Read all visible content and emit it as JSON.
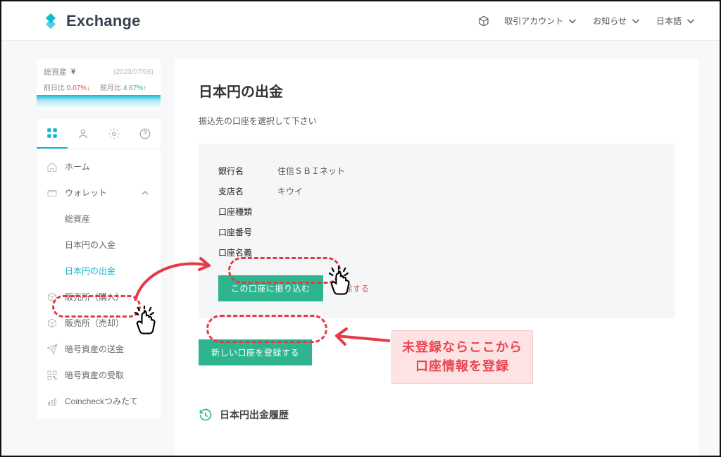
{
  "brand": "Exchange",
  "header": {
    "account": "取引アカウント",
    "notice": "お知らせ",
    "lang": "日本語"
  },
  "portfolio": {
    "label": "総資産",
    "currency": "¥",
    "date": "(2023/07/06)",
    "prev_day_label": "前日比",
    "prev_day_val": "0.07%↓",
    "prev_month_label": "前月比",
    "prev_month_val": "4.67%↑"
  },
  "nav": {
    "home": "ホーム",
    "wallet": "ウォレット",
    "sub": {
      "total": "総資産",
      "deposit_jpy": "日本円の入金",
      "withdraw_jpy": "日本円の出金"
    },
    "exchange_buy": "販売所（購入）",
    "exchange_sell": "販売所（売却）",
    "crypto_send": "暗号資産の送金",
    "crypto_receive": "暗号資産の受取",
    "coincheck_staking": "Coincheckつみたて"
  },
  "page": {
    "title": "日本円の出金",
    "subtitle": "振込先の口座を選択して下さい"
  },
  "bank": {
    "name_label": "銀行名",
    "name_val": "住信ＳＢＩネット",
    "branch_label": "支店名",
    "branch_val": "キウイ",
    "type_label": "口座種類",
    "number_label": "口座番号",
    "holder_label": "口座名義",
    "transfer_btn": "この口座に振り込む",
    "delete_link": "削除する",
    "register_btn": "新しい口座を登録する"
  },
  "history_label": "日本円出金履歴",
  "annotation": {
    "line1": "未登録ならここから",
    "line2": "口座情報を登録"
  }
}
